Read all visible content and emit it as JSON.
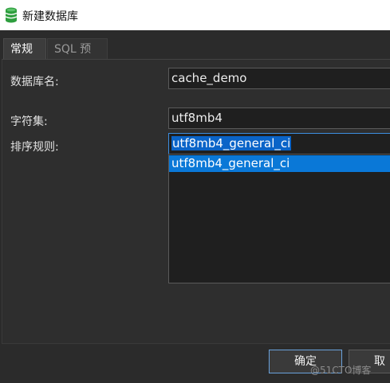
{
  "window": {
    "title": "新建数据库",
    "icon": "database-icon"
  },
  "tabs": [
    {
      "label": "常规",
      "active": true
    },
    {
      "label": "SQL 预览",
      "active": false
    }
  ],
  "form": {
    "db_name_label": "数据库名:",
    "db_name_value": "cache_demo",
    "charset_label": "字符集:",
    "charset_value": "utf8mb4",
    "collation_label": "排序规则:",
    "collation_value": "utf8mb4_general_ci",
    "collation_options": [
      "utf8mb4_general_ci"
    ]
  },
  "buttons": {
    "ok_label": "确定",
    "cancel_label": "取消"
  },
  "watermark": "@51CTO博客",
  "colors": {
    "background": "#2b2b2b",
    "selection": "#0a78d7",
    "accent_border": "#3d8ee0",
    "db_icon": "#2e9e3e"
  }
}
